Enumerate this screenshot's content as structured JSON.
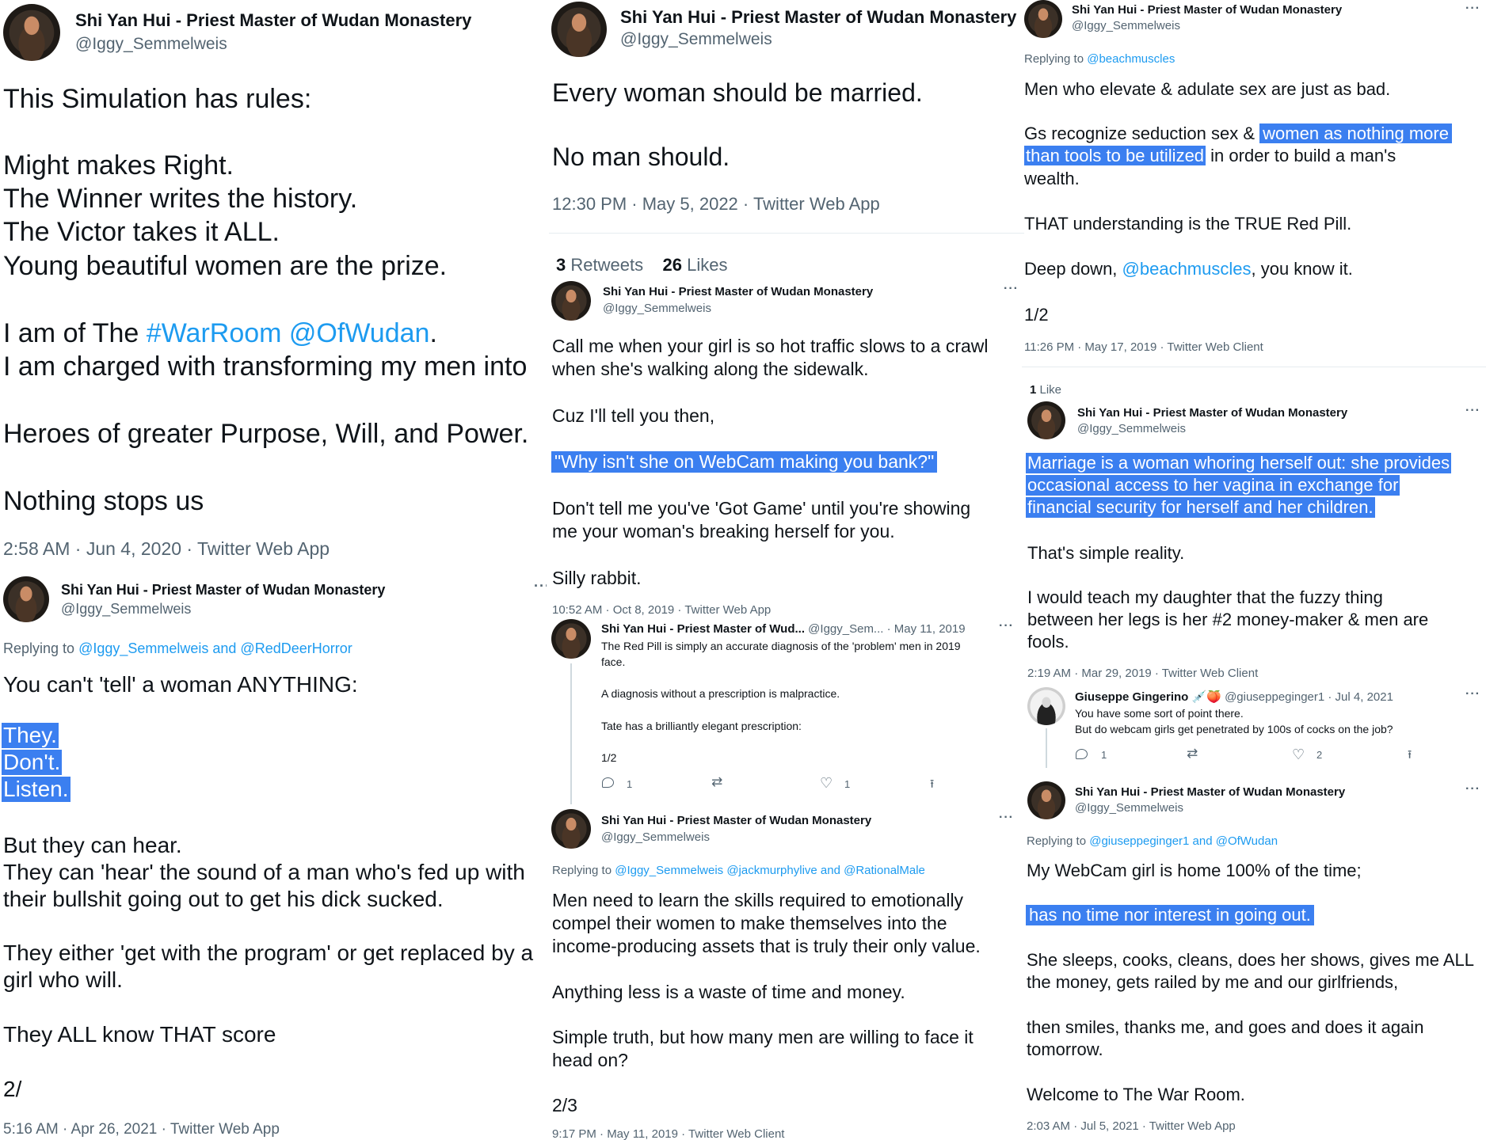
{
  "col1": {
    "tweet1": {
      "name": "Shi Yan Hui - Priest Master of Wudan Monastery",
      "handle": "@Iggy_Semmelweis",
      "line_intro": "This Simulation has rules:",
      "rules": [
        "Might makes Right.",
        "The Winner writes the history.",
        "The Victor takes it ALL.",
        "Young beautiful women are the prize."
      ],
      "line_of_pre": "I am of The ",
      "hashtag": "#WarRoom",
      "mention": "@OfWudan",
      "line_of_post": ".",
      "line_charged": "I am charged with transforming my men into",
      "line_heroes": "Heroes of greater Purpose, Will, and Power.",
      "line_nothing": "Nothing stops us",
      "meta": "2:58 AM · Jun 4, 2020 · Twitter Web App"
    },
    "tweet2": {
      "name": "Shi Yan Hui - Priest Master of Wudan Monastery",
      "handle": "@Iggy_Semmelweis",
      "more": "···",
      "replying_pre": "Replying to ",
      "replying_links": "@Iggy_Semmelweis and @RedDeerHorror",
      "line1": "You can't 'tell' a woman ANYTHING:",
      "hl1": "They.",
      "hl2": "Don't.",
      "hl3": "Listen.",
      "line_hear": "But they can hear.",
      "line_hear2": "They can 'hear' the sound of a man who's fed up with",
      "line_hear3": "their bullshit going out to get his dick sucked.",
      "line_either1": "They either 'get with the program' or get replaced by a",
      "line_either2": "girl who will.",
      "line_all": "They ALL know THAT score",
      "line_num": "2/",
      "meta": "5:16 AM · Apr 26, 2021 · Twitter Web App"
    }
  },
  "col2": {
    "tweet1": {
      "name": "Shi Yan Hui - Priest Master of Wudan Monastery",
      "handle": "@Iggy_Semmelweis",
      "line1": "Every woman should be married.",
      "line2": "No man should.",
      "meta": "12:30 PM · May 5, 2022 · Twitter Web App",
      "retweets_count": "3",
      "retweets_label": " Retweets",
      "likes_count": "26",
      "likes_label": " Likes"
    },
    "tweet2": {
      "name": "Shi Yan Hui - Priest Master of Wudan Monastery",
      "handle": "@Iggy_Semmelweis",
      "more": "···",
      "line1": "Call me when your girl is so hot traffic slows to a crawl",
      "line2": "when she's walking along the sidewalk.",
      "line3": "Cuz I'll tell you then,",
      "hl": "\"Why isn't she on WebCam making you bank?\"",
      "line4": "Don't tell me you've 'Got Game' until you're showing",
      "line5": "me your woman's breaking herself for you.",
      "line6": "Silly rabbit.",
      "meta": "10:52 AM · Oct 8, 2019 · Twitter Web App"
    },
    "tweet3": {
      "name": "Shi Yan Hui - Priest Master of Wud...",
      "handle": "@Iggy_Sem...",
      "date": "· May 11, 2019",
      "more": "···",
      "line1": "The Red Pill is simply an accurate diagnosis of the 'problem' men in 2019",
      "line2": "face.",
      "line3": "A diagnosis without a prescription is malpractice.",
      "line4": "Tate has a brilliantly elegant prescription:",
      "line5": "1/2",
      "reply_count": "1",
      "like_count": "1"
    },
    "tweet4": {
      "name": "Shi Yan Hui - Priest Master of Wudan Monastery",
      "handle": "@Iggy_Semmelweis",
      "more": "···",
      "replying_pre": "Replying to ",
      "replying_links": "@Iggy_Semmelweis @jackmurphylive and @RationalMale",
      "line1": "Men need to learn the skills required to emotionally",
      "line2": "compel their women to make themselves into the",
      "line3": "income-producing assets that is truly their only value.",
      "line4": "Anything less is a waste of time and money.",
      "line5": "Simple truth, but how many men are willing to face it",
      "line6": "head on?",
      "line7": "2/3",
      "meta": "9:17 PM · May 11, 2019 · Twitter Web Client"
    }
  },
  "col3": {
    "tweet1": {
      "name": "Shi Yan Hui - Priest Master of Wudan Monastery",
      "handle": "@Iggy_Semmelweis",
      "more": "···",
      "replying_pre": "Replying to ",
      "replying_link": "@beachmuscles",
      "line1": "Men who elevate & adulate sex are just as bad.",
      "line2_pre": "Gs recognize seduction sex & ",
      "line2_hl": "women as nothing more",
      "line3_hl": "than tools to be utilized",
      "line3_post": " in order to build a man's",
      "line4": "wealth.",
      "line5": "THAT understanding is the TRUE Red Pill.",
      "line6_pre": "Deep down, ",
      "line6_link": "@beachmuscles",
      "line6_post": ", you know it.",
      "line7": "1/2",
      "meta": "11:26 PM · May 17, 2019 · Twitter Web Client",
      "likes_count": "1",
      "likes_label": " Like"
    },
    "tweet2": {
      "name": "Shi Yan Hui - Priest Master of Wudan Monastery",
      "handle": "@Iggy_Semmelweis",
      "more": "···",
      "hl1": "Marriage is a woman whoring herself out: she provides",
      "hl2": "occasional access to her vagina in exchange for",
      "hl3": "financial security for herself and her children.",
      "line1": "That's simple reality.",
      "line2": "I would teach my daughter that the fuzzy thing",
      "line3": "between her legs is her #2 money-maker & men are",
      "line4": "fools.",
      "meta": "2:19 AM · Mar 29, 2019 · Twitter Web Client"
    },
    "tweet3": {
      "name": "Giuseppe Gingerino",
      "emoji": "💉🍑",
      "handle": "@giuseppeginger1",
      "date": "· Jul 4, 2021",
      "more": "···",
      "line1": "You have some sort of point there.",
      "line2": "But do webcam girls get penetrated by 100s of cocks on the job?",
      "reply_count": "1",
      "like_count": "2"
    },
    "tweet4": {
      "name": "Shi Yan Hui - Priest Master of Wudan Monastery",
      "handle": "@Iggy_Semmelweis",
      "more": "···",
      "replying_pre": "Replying to ",
      "replying_links": "@giuseppeginger1 and @OfWudan",
      "line1": "My WebCam girl is home 100% of the time;",
      "hl": "has no time nor interest in going out.",
      "line2": "She sleeps, cooks, cleans, does her shows, gives me ALL",
      "line3": "the money, gets railed by me and our girlfriends,",
      "line4": "then smiles, thanks me, and goes and does it again",
      "line5": "tomorrow.",
      "line6": "Welcome to The War Room.",
      "meta": "2:03 AM · Jul 5, 2021 · Twitter Web App"
    }
  }
}
